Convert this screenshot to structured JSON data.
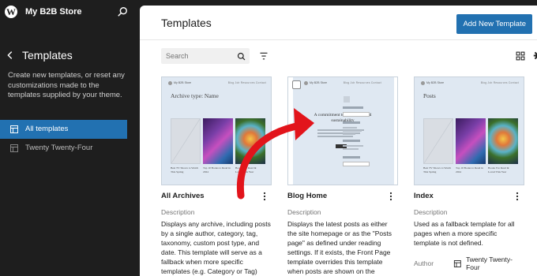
{
  "site": {
    "name": "My B2B Store"
  },
  "sidebar": {
    "title": "Templates",
    "description": "Create new templates, or reset any customizations made to the templates supplied by your theme.",
    "items": [
      {
        "label": "All templates",
        "active": true
      },
      {
        "label": "Twenty Twenty-Four",
        "active": false
      }
    ]
  },
  "header": {
    "title": "Templates",
    "add_label": "Add New Template"
  },
  "search": {
    "placeholder": "Search"
  },
  "colors": {
    "accent": "#2271b1",
    "arrow": "#e2141b",
    "sidebar_bg": "#1e1e1e"
  },
  "cards": [
    {
      "name": "All Archives",
      "thumb_title": "Archive type: Name",
      "description_label": "Description",
      "description": "Displays any archive, including posts by a single author, category, tag, taxonomy, custom post type, and date. This template will serve as a fallback when more specific templates (e.g. Category or Tag) cannot be found.",
      "captions": [
        "Best TV Shows to Watch This Spring",
        "Top 10 Books to Read in 2024",
        "Books I've Read & Loved This Year"
      ]
    },
    {
      "name": "Blog Home",
      "thumb_heading": "A commitment to innovation and sustainability",
      "description_label": "Description",
      "description": "Displays the latest posts as either the site homepage or as the \"Posts page\" as defined under reading settings. If it exists, the Front Page template overrides this template when posts are shown on the homepage."
    },
    {
      "name": "Index",
      "thumb_title": "Posts",
      "description_label": "Description",
      "description": "Used as a fallback template for all pages when a more specific template is not defined.",
      "author_label": "Author",
      "author": "Twenty Twenty-Four",
      "captions": [
        "Best TV Shows to Watch This Spring",
        "Top 10 Books to Read in 2024",
        "Books I've Read & Loved This Year"
      ]
    }
  ],
  "mini_site": "My B2B Store",
  "mini_links": "Blog  Job  Resources  Contact"
}
